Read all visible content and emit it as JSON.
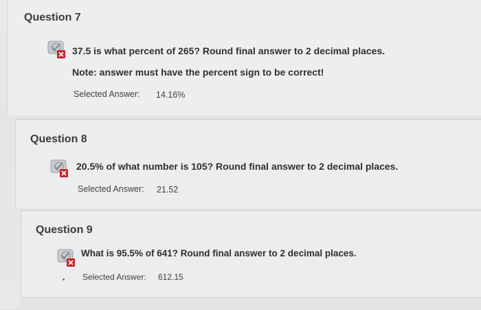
{
  "questions": [
    {
      "title": "Question 7",
      "text": "37.5 is what percent of 265? Round final answer to 2 decimal places.",
      "note": "Note: answer must have the percent sign to be correct!",
      "selected_label": "Selected Answer:",
      "selected_value": "14.16%",
      "status_icon": "incorrect-icon"
    },
    {
      "title": "Question 8",
      "text": "20.5% of what number is 105? Round final answer to 2 decimal places.",
      "selected_label": "Selected Answer:",
      "selected_value": "21.52",
      "status_icon": "incorrect-icon"
    },
    {
      "title": "Question 9",
      "text": "What is 95.5% of 641? Round final answer to 2 decimal places.",
      "selected_label": "Selected Answer:",
      "selected_value": "612.15",
      "status_icon": "incorrect-icon"
    }
  ],
  "colors": {
    "incorrect": "#c7252b",
    "text": "#2f2f31"
  }
}
